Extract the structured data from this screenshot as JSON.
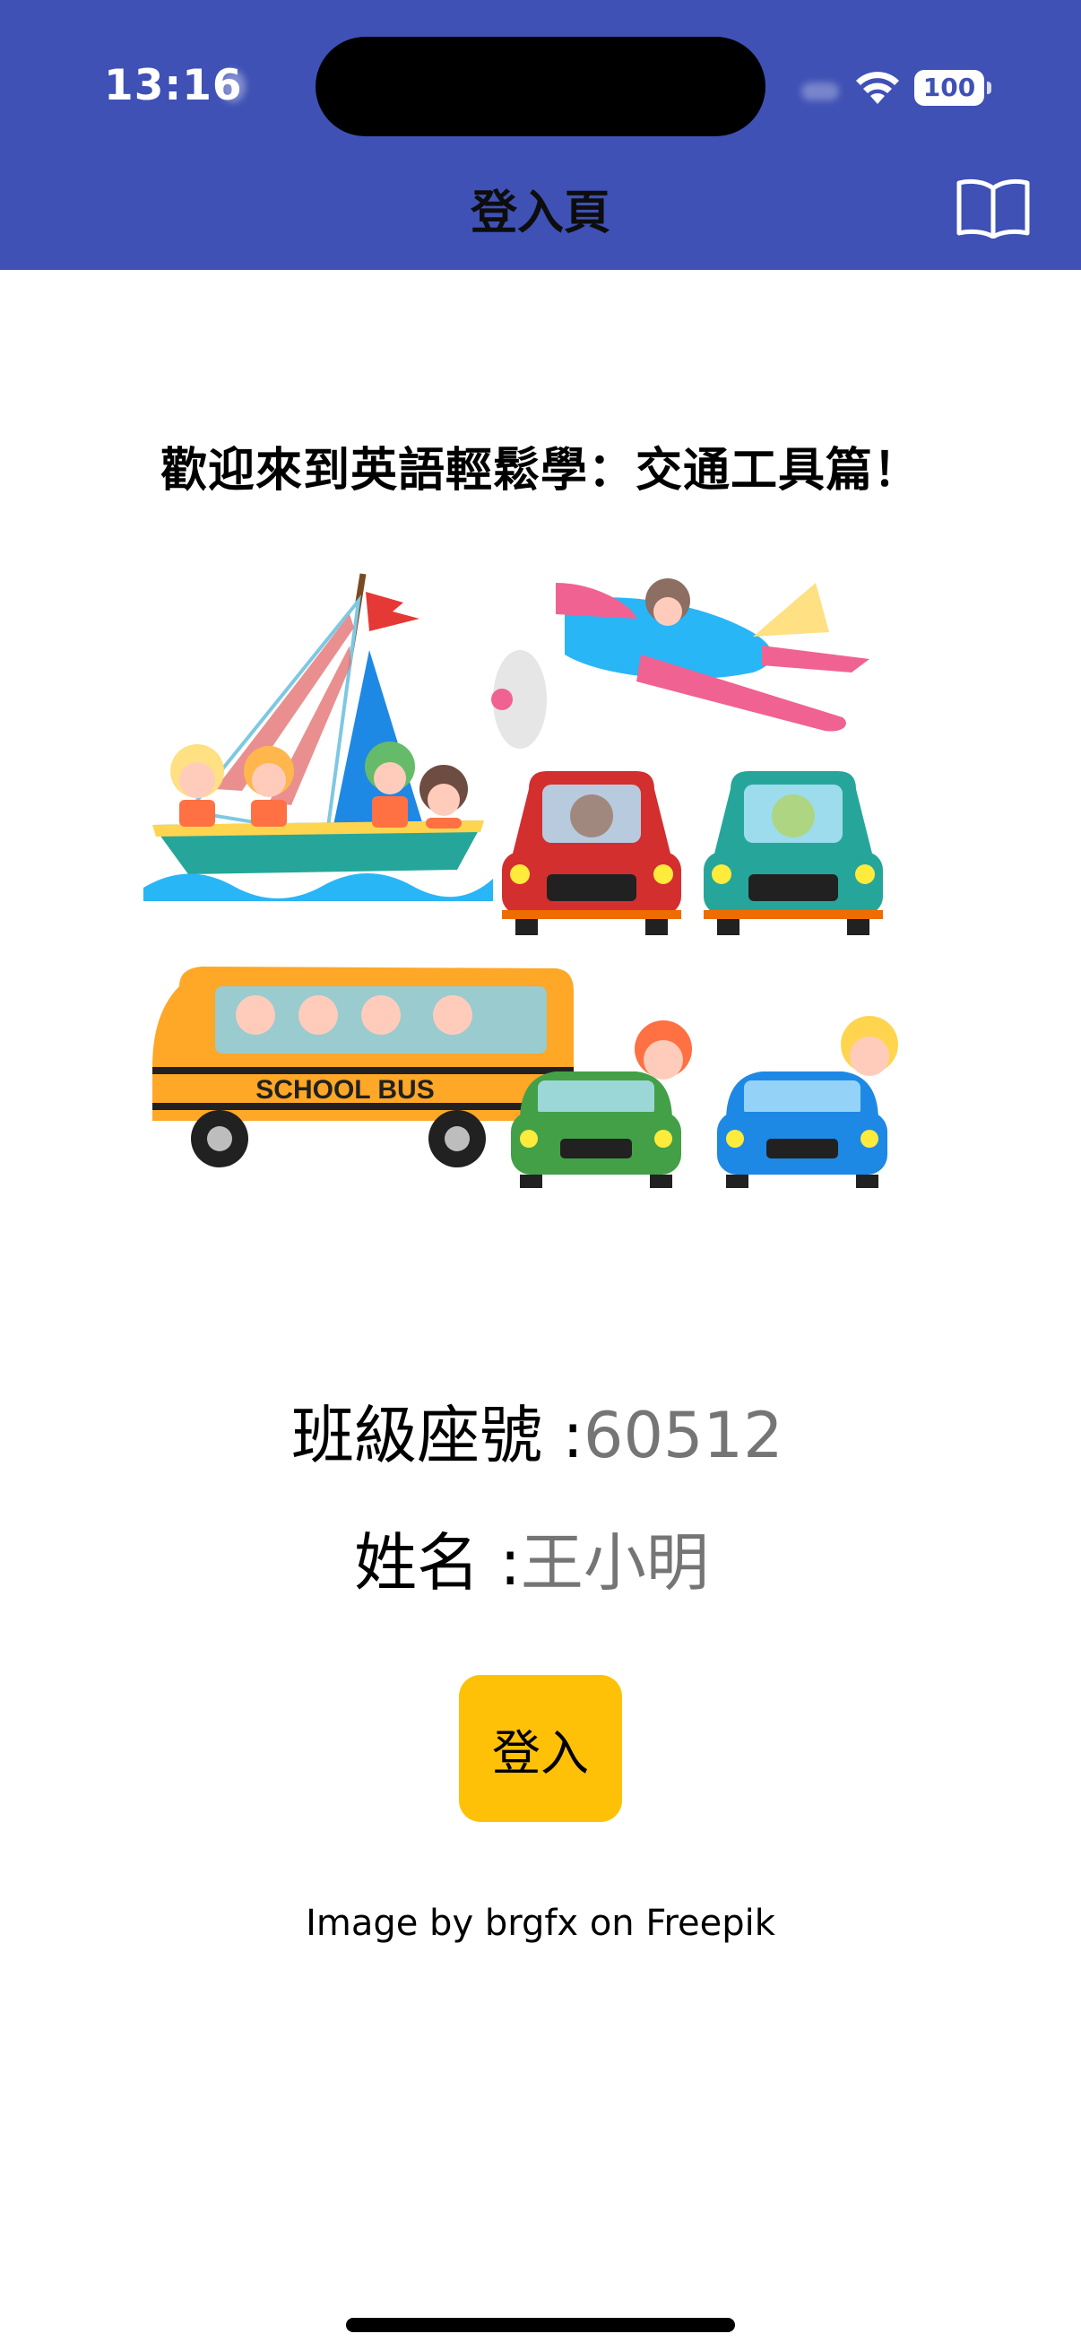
{
  "status_bar": {
    "time": "13:16",
    "battery": "100"
  },
  "nav": {
    "title": "登入頁",
    "right_icon": "book-icon"
  },
  "welcome": "歡迎來到英語輕鬆學：交通工具篇！",
  "illustration": {
    "bus_text": "SCHOOL BUS"
  },
  "form": {
    "class_label": "班級座號 :",
    "class_placeholder": "60512",
    "name_label": "姓名 :",
    "name_placeholder": "王小明",
    "login_label": "登入"
  },
  "credit": "Image by brgfx on Freepik",
  "colors": {
    "header": "#3f51b5",
    "button": "#ffc107",
    "placeholder": "#888888"
  }
}
